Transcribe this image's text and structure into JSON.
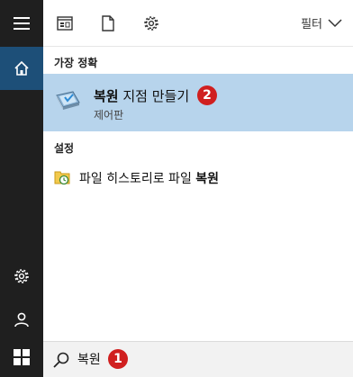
{
  "toolbar": {
    "filter_label": "필터"
  },
  "best_match": {
    "heading": "가장 정확",
    "title_bold": "복원",
    "title_rest": " 지점 만들기",
    "subtitle": "제어판",
    "badge": "2"
  },
  "settings": {
    "heading": "설정",
    "items": [
      {
        "label_prefix": "파일 히스토리로 파일 ",
        "label_bold": "복원"
      }
    ]
  },
  "search": {
    "query": "복원",
    "badge": "1"
  },
  "colors": {
    "rail_bg": "#1f1f1f",
    "rail_active": "#1d4f78",
    "highlight": "#b7d4ec",
    "badge": "#d01f1f"
  }
}
